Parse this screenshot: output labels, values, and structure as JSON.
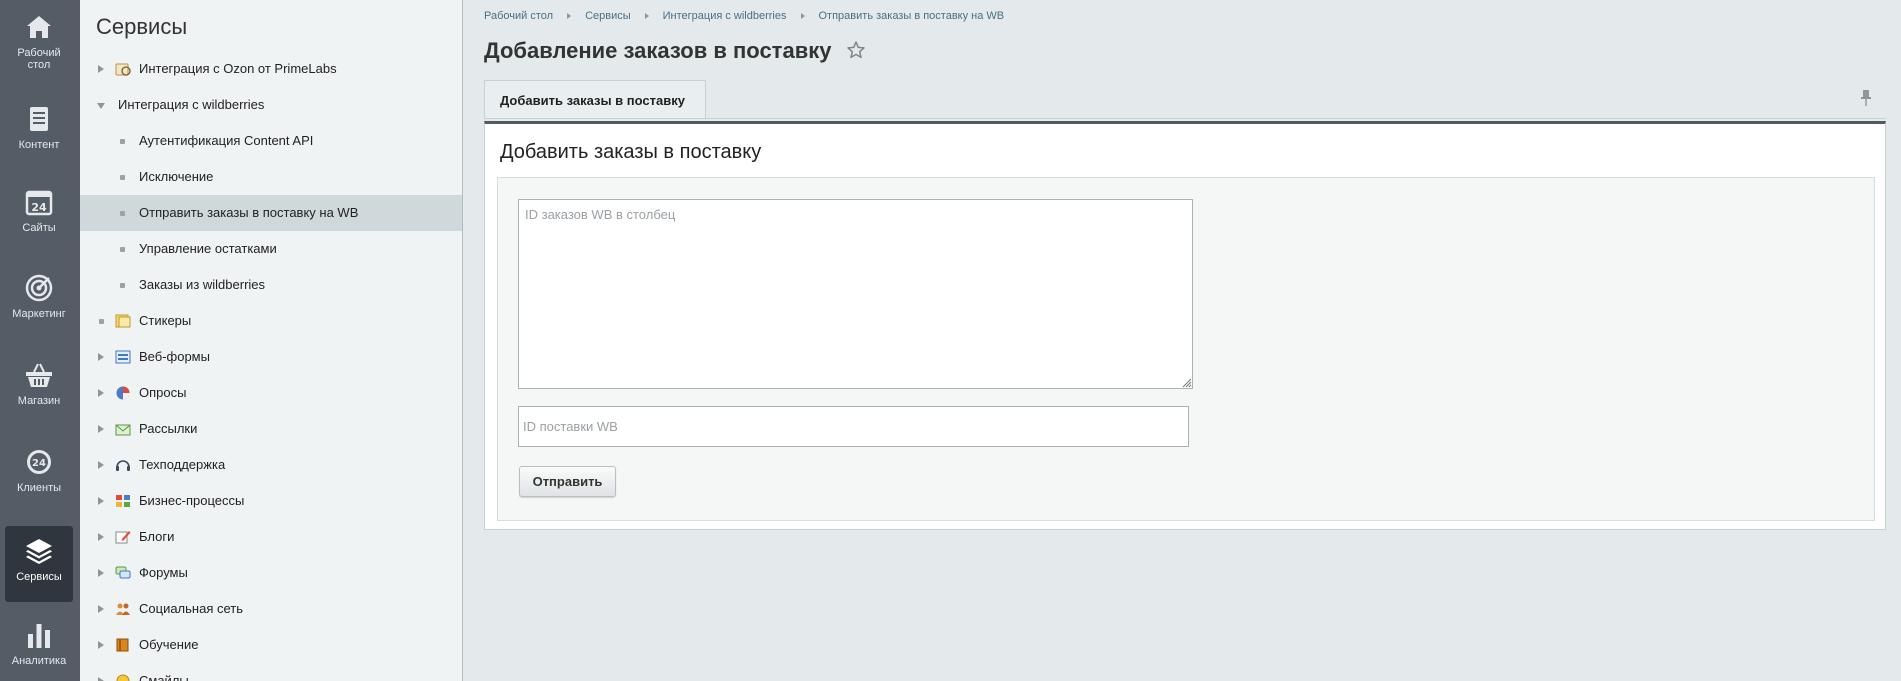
{
  "rail": {
    "items": [
      {
        "label": "Рабочий стол",
        "icon": "house-icon"
      },
      {
        "label": "Контент",
        "icon": "document-icon"
      },
      {
        "label": "Сайты",
        "icon": "calendar-24-icon"
      },
      {
        "label": "Маркетинг",
        "icon": "target-icon"
      },
      {
        "label": "Магазин",
        "icon": "basket-icon"
      },
      {
        "label": "Клиенты",
        "icon": "clients-24-icon"
      },
      {
        "label": "Сервисы",
        "icon": "layers-icon",
        "active": true
      },
      {
        "label": "Аналитика",
        "icon": "bar-chart-icon"
      }
    ]
  },
  "sidebar": {
    "title": "Сервисы",
    "items": [
      {
        "label": "Интеграция с Ozon от PrimeLabs",
        "icon": "ozon-module-icon",
        "expandable": true
      },
      {
        "label": "Интеграция с wildberries",
        "expanded": true
      },
      {
        "label": "Аутентификация Content API",
        "child": true
      },
      {
        "label": "Исключение",
        "child": true
      },
      {
        "label": "Отправить заказы в поставку на WB",
        "child": true,
        "selected": true
      },
      {
        "label": "Управление остатками",
        "child": true
      },
      {
        "label": "Заказы из wildberries",
        "child": true
      },
      {
        "label": "Стикеры",
        "icon": "stickers-icon"
      },
      {
        "label": "Веб-формы",
        "icon": "web-forms-icon",
        "expandable": true
      },
      {
        "label": "Опросы",
        "icon": "polls-icon",
        "expandable": true
      },
      {
        "label": "Рассылки",
        "icon": "mail-icon",
        "expandable": true
      },
      {
        "label": "Техподдержка",
        "icon": "headset-icon",
        "expandable": true
      },
      {
        "label": "Бизнес-процессы",
        "icon": "workflow-icon",
        "expandable": true
      },
      {
        "label": "Блоги",
        "icon": "blog-icon",
        "expandable": true
      },
      {
        "label": "Форумы",
        "icon": "forum-icon",
        "expandable": true
      },
      {
        "label": "Социальная сеть",
        "icon": "social-icon",
        "expandable": true
      },
      {
        "label": "Обучение",
        "icon": "learning-icon",
        "expandable": true
      },
      {
        "label": "Смайлы",
        "icon": "smile-icon",
        "expandable": true
      }
    ]
  },
  "breadcrumb": [
    "Рабочий стол",
    "Сервисы",
    "Интеграция с wildberries",
    "Отправить заказы в поставку на WB"
  ],
  "page": {
    "title": "Добавление заказов в поставку",
    "tab_label": "Добавить заказы в поставку",
    "panel_title": "Добавить заказы в поставку",
    "orders_placeholder": "ID заказов WB в столбец",
    "orders_value": "",
    "supply_placeholder": "ID поставки WB",
    "supply_value": "",
    "submit_label": "Отправить"
  },
  "colors": {
    "rail_bg": "#545c66",
    "rail_active_bg": "#2f363d",
    "sidebar_bg": "#f0f3f4",
    "selected_item_bg": "#cfd9dc",
    "link": "#4a6e85"
  }
}
